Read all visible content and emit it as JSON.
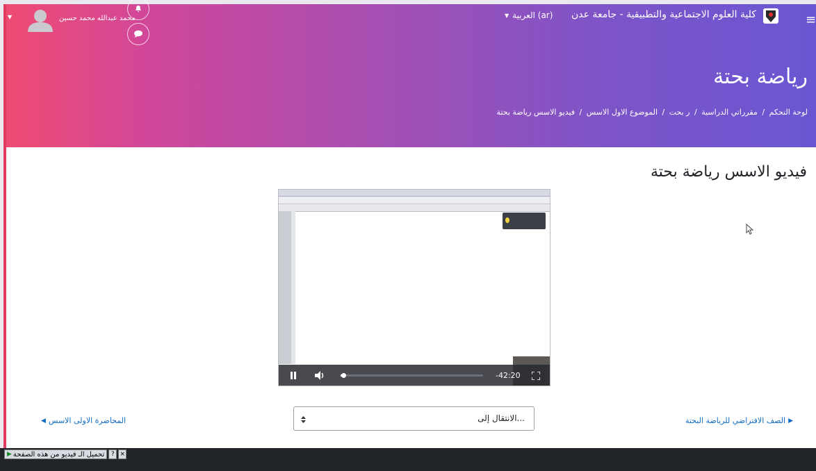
{
  "site": {
    "name": "كلية العلوم الاجتماعية والتطبيقية - جامعة عدن",
    "language": "العربية (ar)"
  },
  "user": {
    "name": "محمد عبدالله محمد حسين"
  },
  "page": {
    "heading": "رياضة بحتة",
    "activity_title": "فيديو الاسس رياضة بحتة"
  },
  "breadcrumb": [
    {
      "label": "لوحة التحكم",
      "sep": "/"
    },
    {
      "label": "مقرراتي الدراسية",
      "sep": "/"
    },
    {
      "label": "ر بحت",
      "sep": "/"
    },
    {
      "label": "الموضوع الاول الاسس",
      "sep": "/"
    },
    {
      "label": "فيديو الاسس رياضة بحتة",
      "sep": ""
    }
  ],
  "video": {
    "time_remaining": "-42:20",
    "progress": 0.02
  },
  "navigation": {
    "prev_label": "الصف الافتراضي للرياضة البحتة",
    "next_label": "المحاضرة الاولى الاسس",
    "jump_placeholder": "الانتقال إلى..."
  },
  "download_bar": {
    "label": "تحميل الـ فيديو من هذه الصفحة"
  },
  "colors": {
    "gradient_start": "#ef4b71",
    "gradient_end": "#6a56d2",
    "link": "#0f6cbf"
  }
}
